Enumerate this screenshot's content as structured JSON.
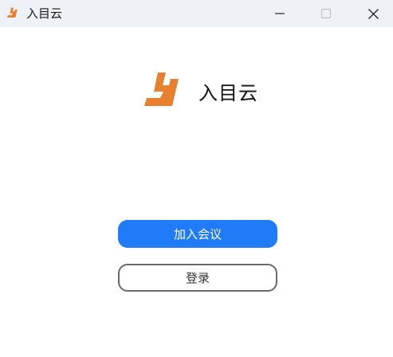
{
  "window": {
    "title": "入目云",
    "logo_icon": "app-logo-icon",
    "controls": {
      "minimize_icon": "minimize-icon",
      "maximize_icon": "maximize-icon",
      "close_icon": "close-icon"
    }
  },
  "brand": {
    "name": "入目云",
    "logo_icon": "app-logo-icon",
    "logo_color": "#e8802e"
  },
  "actions": {
    "join_meeting_label": "加入会议",
    "login_label": "登录"
  },
  "colors": {
    "titlebar": "#eef1f5",
    "primary": "#1f7bf7",
    "outline": "#666a70"
  }
}
